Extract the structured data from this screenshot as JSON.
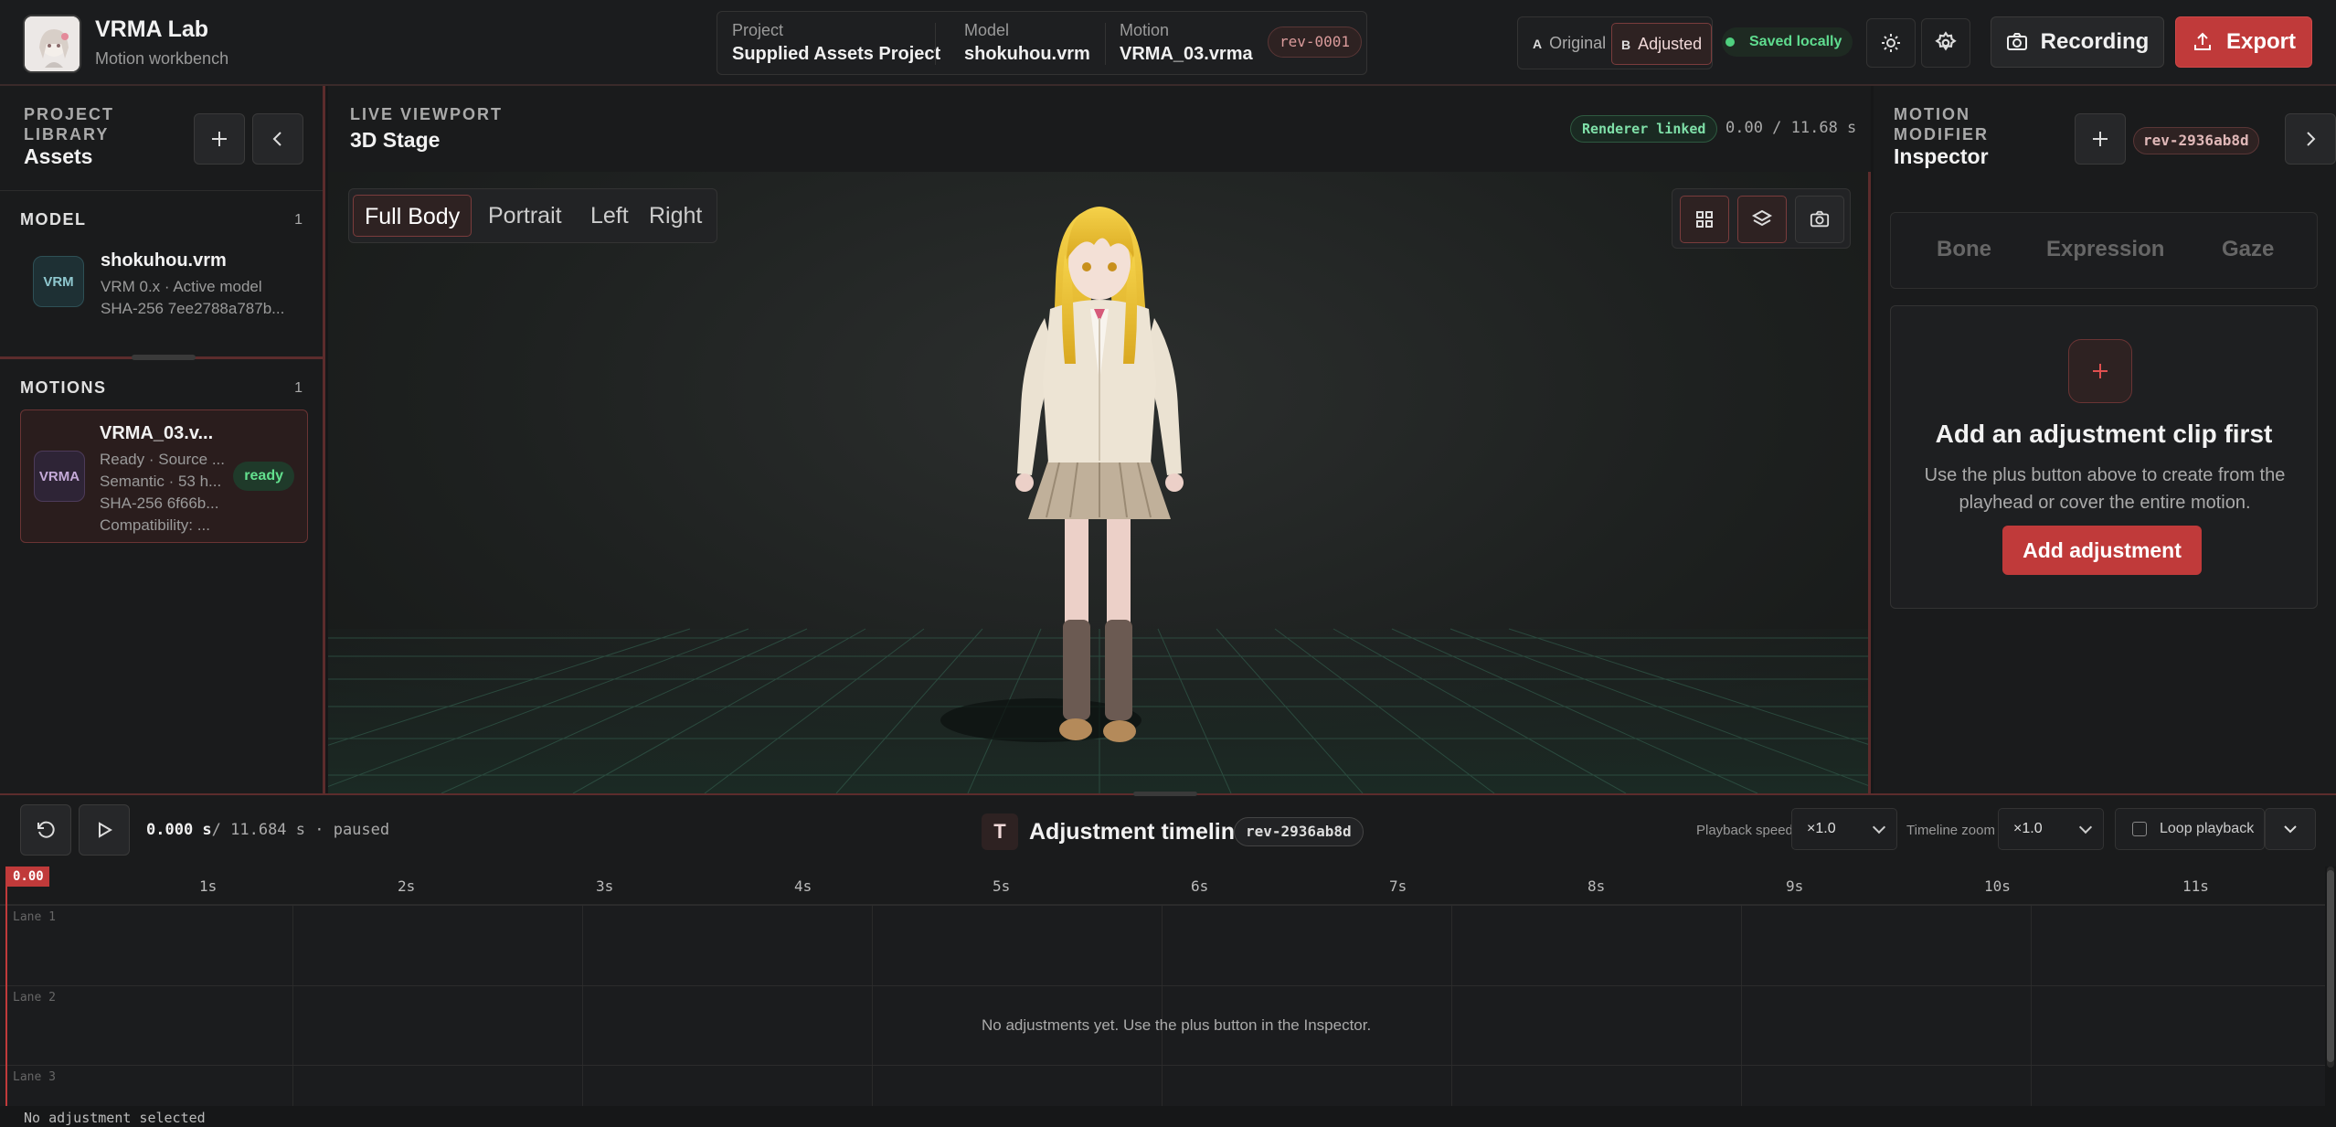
{
  "app": {
    "title": "VRMA Lab",
    "subtitle": "Motion workbench"
  },
  "project_bar": {
    "project_label": "Project",
    "project_value": "Supplied Assets Project",
    "model_label": "Model",
    "model_value": "shokuhou.vrm",
    "motion_label": "Motion",
    "motion_value": "VRMA_03.vrma",
    "revision": "rev-0001"
  },
  "ab_toggle": {
    "a_key": "A",
    "a_label": "Original",
    "b_key": "B",
    "b_label": "Adjusted",
    "active": "B"
  },
  "saved_status": "Saved locally",
  "header_buttons": {
    "recording": "Recording",
    "export": "Export"
  },
  "left_panel": {
    "kicker": "PROJECT LIBRARY",
    "title": "Assets",
    "model_section": {
      "label": "MODEL",
      "count": "1"
    },
    "model": {
      "badge": "VRM",
      "name": "shokuhou.vrm",
      "meta1": "VRM 0.x · Active model",
      "meta2": "SHA-256 7ee2788a787b..."
    },
    "motions_section": {
      "label": "MOTIONS",
      "count": "1"
    },
    "motion": {
      "badge": "VRMA",
      "name": "VRMA_03.v...",
      "meta1": "Ready · Source ...",
      "meta2": "Semantic · 53 h...",
      "meta3": "SHA-256 6f66b...",
      "meta4": "Compatibility: ...",
      "status": "ready"
    }
  },
  "viewport": {
    "kicker": "LIVE VIEWPORT",
    "title": "3D Stage",
    "renderer_status": "Renderer linked",
    "time": "0.00 / 11.68 s",
    "camera_presets": [
      "Full Body",
      "Portrait",
      "Left",
      "Right"
    ],
    "active_preset": "Full Body",
    "tools": [
      "grid-icon",
      "layers-icon",
      "camera-icon"
    ]
  },
  "inspector": {
    "kicker": "MOTION MODIFIER",
    "title": "Inspector",
    "revision": "rev-2936ab8d",
    "tabs": [
      "Bone",
      "Expression",
      "Gaze"
    ],
    "empty_title": "Add an adjustment clip first",
    "empty_text": "Use the plus button above to create from the playhead or cover the entire motion.",
    "add_button": "Add adjustment"
  },
  "timeline": {
    "time_current": "0.000 s",
    "time_rest": "/ 11.684 s · paused",
    "title_icon": "T",
    "title": "Adjustment timeline",
    "revision": "rev-2936ab8d",
    "speed_label": "Playback speed",
    "speed_value": "×1.0",
    "zoom_label": "Timeline zoom",
    "zoom_value": "×1.0",
    "loop_label": "Loop playback",
    "playhead_label": "0.00",
    "ticks": [
      "1s",
      "2s",
      "3s",
      "4s",
      "5s",
      "6s",
      "7s",
      "8s",
      "9s",
      "10s",
      "11s"
    ],
    "lanes": [
      "Lane 1",
      "Lane 2",
      "Lane 3"
    ],
    "empty_text": "No adjustments yet. Use the plus button in the Inspector.",
    "status": "No adjustment selected"
  },
  "colors": {
    "accent": "#c03a3a",
    "success": "#4fd07f",
    "background": "#161718"
  }
}
